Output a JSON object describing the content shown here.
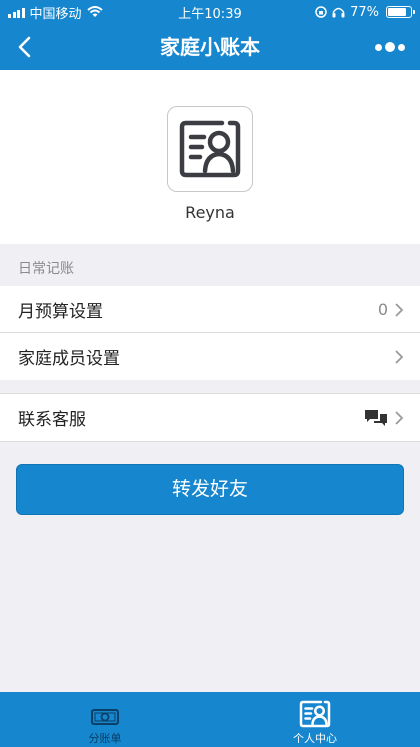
{
  "status_bar": {
    "carrier": "中国移动",
    "time": "上午10:39",
    "battery": "77%"
  },
  "nav": {
    "title": "家庭小账本"
  },
  "profile": {
    "username": "Reyna"
  },
  "section": {
    "header": "日常记账"
  },
  "rows": {
    "budget": {
      "label": "月预算设置",
      "value": "0"
    },
    "members": {
      "label": "家庭成员设置"
    },
    "support": {
      "label": "联系客服"
    }
  },
  "share_button": "转发好友",
  "tabs": [
    {
      "label": "分账单",
      "active": false
    },
    {
      "label": "个人中心",
      "active": true
    }
  ],
  "colors": {
    "primary": "#1686cf",
    "background": "#f0eff4",
    "tab_inactive_text": "#0a3f66"
  },
  "icons": {
    "back": "chevron-left-icon",
    "more": "more-dots-icon",
    "avatar": "profile-card-icon",
    "support": "chat-bubbles-icon",
    "tab_bills": "money-bill-icon",
    "tab_profile": "profile-card-icon"
  }
}
